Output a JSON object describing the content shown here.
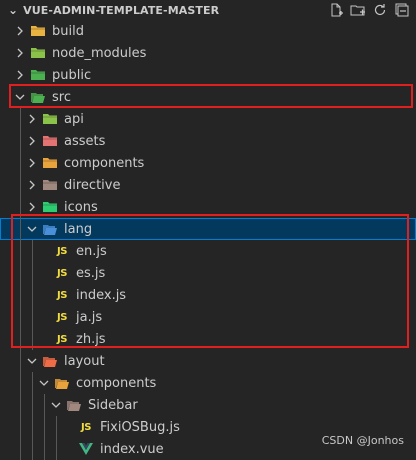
{
  "explorer": {
    "chevron": "⌄",
    "title": "VUE-ADMIN-TEMPLATE-MASTER",
    "actions": [
      "new-file-icon",
      "new-folder-icon",
      "refresh-icon",
      "collapse-all-icon"
    ]
  },
  "tree": [
    {
      "label": "build",
      "type": "folder",
      "depth": 0,
      "expanded": false,
      "icon": "folder-build-icon",
      "color": "#e8b340"
    },
    {
      "label": "node_modules",
      "type": "folder",
      "depth": 0,
      "expanded": false,
      "icon": "folder-node-icon",
      "color": "#8bc34a"
    },
    {
      "label": "public",
      "type": "folder",
      "depth": 0,
      "expanded": false,
      "icon": "folder-public-icon",
      "color": "#4caf50"
    },
    {
      "label": "src",
      "type": "folder",
      "depth": 0,
      "expanded": true,
      "icon": "folder-src-icon",
      "color": "#4caf50"
    },
    {
      "label": "api",
      "type": "folder",
      "depth": 1,
      "expanded": false,
      "icon": "folder-api-icon",
      "color": "#8bc34a"
    },
    {
      "label": "assets",
      "type": "folder",
      "depth": 1,
      "expanded": false,
      "icon": "folder-assets-icon",
      "color": "#e57373"
    },
    {
      "label": "components",
      "type": "folder",
      "depth": 1,
      "expanded": false,
      "icon": "folder-components-icon",
      "color": "#e8a33d"
    },
    {
      "label": "directive",
      "type": "folder",
      "depth": 1,
      "expanded": false,
      "icon": "folder-icon",
      "color": "#a1887f"
    },
    {
      "label": "icons",
      "type": "folder",
      "depth": 1,
      "expanded": false,
      "icon": "folder-icons-icon",
      "color": "#2ecc71"
    },
    {
      "label": "lang",
      "type": "folder",
      "depth": 1,
      "expanded": true,
      "selected": true,
      "icon": "folder-lang-icon",
      "color": "#4a90d9"
    },
    {
      "label": "en.js",
      "type": "js",
      "depth": 2
    },
    {
      "label": "es.js",
      "type": "js",
      "depth": 2
    },
    {
      "label": "index.js",
      "type": "js",
      "depth": 2
    },
    {
      "label": "ja.js",
      "type": "js",
      "depth": 2
    },
    {
      "label": "zh.js",
      "type": "js",
      "depth": 2
    },
    {
      "label": "layout",
      "type": "folder",
      "depth": 1,
      "expanded": true,
      "icon": "folder-layout-icon",
      "color": "#ef6c47"
    },
    {
      "label": "components",
      "type": "folder",
      "depth": 2,
      "expanded": true,
      "icon": "folder-components-icon",
      "color": "#e8a33d"
    },
    {
      "label": "Sidebar",
      "type": "folder",
      "depth": 3,
      "expanded": true,
      "icon": "folder-icon",
      "color": "#a1887f"
    },
    {
      "label": "FixiOSBug.js",
      "type": "js",
      "depth": 4
    },
    {
      "label": "index.vue",
      "type": "vue",
      "depth": 4
    }
  ],
  "js_badge": "JS",
  "watermark": "CSDN @Jonhos",
  "colors": {
    "background": "#252526",
    "selection": "#04395e",
    "focus_border": "#007fd4",
    "highlight_box": "#e02020",
    "js": "#f1dd3f",
    "vue": "#41b883"
  }
}
